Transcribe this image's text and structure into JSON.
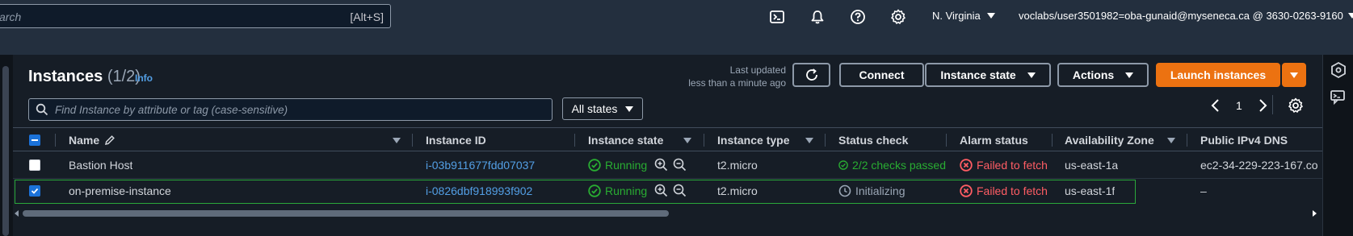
{
  "topnav": {
    "search_placeholder": "arch",
    "search_shortcut": "[Alt+S]",
    "icons": [
      "cloudshell-icon",
      "notifications-icon",
      "help-icon",
      "settings-icon"
    ],
    "region": "N. Virginia",
    "account": "voclabs/user3501982=oba-gunaid@myseneca.ca @ 3630-0263-9160"
  },
  "header": {
    "title": "Instances",
    "count": "(1/2)",
    "info_link": "Info",
    "last_updated_line1": "Last updated",
    "last_updated_line2": "less than a minute ago",
    "connect_label": "Connect",
    "instance_state_label": "Instance state",
    "actions_label": "Actions",
    "launch_label": "Launch instances"
  },
  "filter": {
    "placeholder": "Find Instance by attribute or tag (case-sensitive)",
    "states_label": "All states",
    "page": "1"
  },
  "table": {
    "columns": [
      "Name",
      "Instance ID",
      "Instance state",
      "Instance type",
      "Status check",
      "Alarm status",
      "Availability Zone",
      "Public IPv4 DNS"
    ],
    "rows": [
      {
        "name": "Bastion Host",
        "instance_id": "i-03b911677fdd07037",
        "state": "Running",
        "type": "t2.micro",
        "status_check": "2/2 checks passed",
        "alarm": "Failed to fetch",
        "az": "us-east-1a",
        "dns": "ec2-34-229-223-167.co",
        "selected": false
      },
      {
        "name": "on-premise-instance",
        "instance_id": "i-0826dbf918993f902",
        "state": "Running",
        "type": "t2.micro",
        "status_check": "Initializing",
        "alarm": "Failed to fetch",
        "az": "us-east-1f",
        "dns": "–",
        "selected": true
      }
    ]
  },
  "colors": {
    "nav_bg": "#232f3e",
    "panel_bg": "#161d26",
    "primary": "#ec7211",
    "link": "#539fe5",
    "success": "#29ad32",
    "error": "#ff5d64",
    "selected_border": "#2aa83a"
  }
}
